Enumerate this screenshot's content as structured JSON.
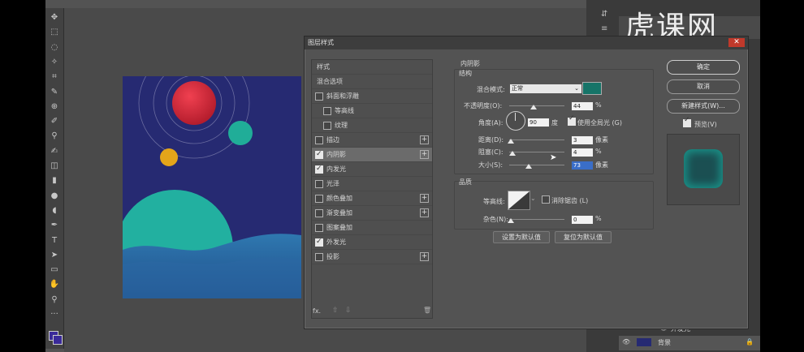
{
  "colors": {
    "app_bg": "#535353",
    "canvas_bg": "#262a72",
    "red_planet": "#d8283a",
    "teal": "#20ad98",
    "wave": "#2a6aa0",
    "inner_shadow_swatch": "#167468",
    "fg_color": "#3a2a9a"
  },
  "tools": [
    "move-icon",
    "marquee-icon",
    "lasso-icon",
    "magic-wand-icon",
    "crop-icon",
    "eyedropper-icon",
    "healing-icon",
    "brush-icon",
    "stamp-icon",
    "history-brush-icon",
    "eraser-icon",
    "gradient-icon",
    "blur-icon",
    "dodge-icon",
    "pen-icon",
    "type-icon",
    "path-select-icon",
    "shape-icon",
    "hand-icon",
    "zoom-icon",
    "more-icon"
  ],
  "tool_glyphs": [
    "✥",
    "⬚",
    "◌",
    "✧",
    "⌗",
    "✎",
    "⊕",
    "✐",
    "⚲",
    "✍",
    "◫",
    "▮",
    "●",
    "◖",
    "✒",
    "T",
    "➤",
    "▭",
    "✋",
    "⚲",
    "···"
  ],
  "watermark": "虎课网",
  "layers_panel": {
    "item_label": "外发光",
    "background_label": "背景"
  },
  "dialog": {
    "title": "图层样式",
    "left_list": [
      {
        "label": "样式",
        "check": null,
        "plus": false,
        "indent": false,
        "selected": false
      },
      {
        "label": "混合选项",
        "check": null,
        "plus": false,
        "indent": false,
        "selected": false
      },
      {
        "label": "斜面和浮雕",
        "check": false,
        "plus": false,
        "indent": false,
        "selected": false
      },
      {
        "label": "等高线",
        "check": false,
        "plus": false,
        "indent": true,
        "selected": false
      },
      {
        "label": "纹理",
        "check": false,
        "plus": false,
        "indent": true,
        "selected": false
      },
      {
        "label": "描边",
        "check": false,
        "plus": true,
        "indent": false,
        "selected": false
      },
      {
        "label": "内阴影",
        "check": true,
        "plus": true,
        "indent": false,
        "selected": true
      },
      {
        "label": "内发光",
        "check": true,
        "plus": false,
        "indent": false,
        "selected": false
      },
      {
        "label": "光泽",
        "check": false,
        "plus": false,
        "indent": false,
        "selected": false
      },
      {
        "label": "颜色叠加",
        "check": false,
        "plus": true,
        "indent": false,
        "selected": false
      },
      {
        "label": "渐变叠加",
        "check": false,
        "plus": true,
        "indent": false,
        "selected": false
      },
      {
        "label": "图案叠加",
        "check": false,
        "plus": false,
        "indent": false,
        "selected": false
      },
      {
        "label": "外发光",
        "check": true,
        "plus": false,
        "indent": false,
        "selected": false
      },
      {
        "label": "投影",
        "check": false,
        "plus": true,
        "indent": false,
        "selected": false
      }
    ],
    "footer": {
      "fx": "fx.",
      "up": "⇧",
      "down": "⇩",
      "trash": "🗑"
    },
    "section_title": "内阴影",
    "structure": {
      "title": "结构",
      "blend_mode_label": "混合模式:",
      "blend_mode_value": "正常",
      "opacity_label": "不透明度(O):",
      "opacity_value": "44",
      "opacity_unit": "%",
      "angle_label": "角度(A):",
      "angle_value": "90",
      "angle_unit": "度",
      "global_light_label": "使用全局光 (G)",
      "global_light_checked": true,
      "distance_label": "距离(D):",
      "distance_value": "3",
      "distance_unit": "像素",
      "choke_label": "阻塞(C):",
      "choke_value": "4",
      "choke_unit": "%",
      "size_label": "大小(S):",
      "size_value": "73",
      "size_unit": "像素"
    },
    "quality": {
      "title": "品质",
      "contour_label": "等高线:",
      "antialias_label": "消除锯齿 (L)",
      "antialias_checked": false,
      "noise_label": "杂色(N):",
      "noise_value": "0",
      "noise_unit": "%"
    },
    "set_default_label": "设置为默认值",
    "reset_default_label": "复位为默认值",
    "right_buttons": {
      "ok": "确定",
      "cancel": "取消",
      "new_style": "新建样式(W)...",
      "preview_label": "预览(V)",
      "preview_checked": true
    }
  }
}
